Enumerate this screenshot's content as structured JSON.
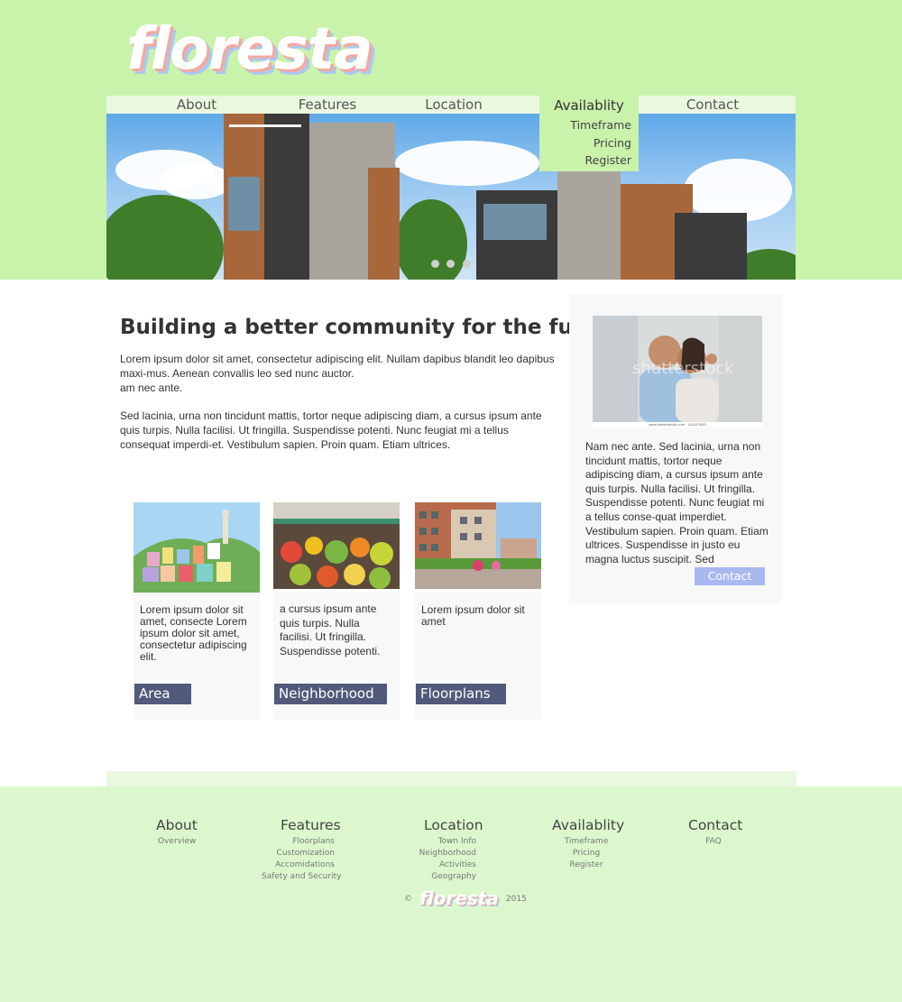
{
  "brand": {
    "logo_text": "floresta"
  },
  "nav": {
    "about": "About",
    "features": "Features",
    "location": "Location",
    "availability": "Availablity",
    "availability_sub": [
      "Timeframe",
      "Pricing",
      "Register"
    ],
    "contact": "Contact"
  },
  "hero": {
    "slide_count": 3
  },
  "main": {
    "headline": "Building a better community for the future™",
    "intro_p1": "Lorem ipsum dolor sit amet, consectetur adipiscing elit. Nullam dapibus blandit leo dapibus maxi-mus. Aenean convallis leo sed nunc auctor.",
    "intro_p1_tail": "am nec ante.",
    "intro_p2": "Sed lacinia, urna non tincidunt mattis, tortor neque adipiscing diam, a cursus ipsum ante quis turpis. Nulla facilisi. Ut fringilla. Suspendisse potenti. Nunc feugiat mi a tellus consequat imperdi-et. Vestibulum sapien. Proin quam. Etiam ultrices."
  },
  "cards": [
    {
      "text": "Lorem ipsum dolor sit amet, consecte  Lorem ipsum dolor sit amet, consectetur adipiscing elit.",
      "tag": "Area"
    },
    {
      "text": "a cursus ipsum ante quis turpis. Nulla facilisi. Ut fringilla. Suspendisse potenti.",
      "tag": "Neighborhood"
    },
    {
      "text": "Lorem ipsum dolor sit amet",
      "tag": "Floorplans"
    }
  ],
  "sidebar": {
    "photo_watermark": "shutterstock",
    "photo_caption": "www.shutterstock.com · 151413953",
    "text": "Nam nec ante. Sed lacinia, urna non tincidunt mattis, tortor neque adipiscing diam, a cursus ipsum ante quis turpis. Nulla facilisi. Ut fringilla. Suspendisse potenti. Nunc feugiat mi a tellus conse-quat imperdiet. Vestibulum sapien. Proin quam. Etiam ultrices. Suspendisse in justo eu magna luctus suscipit. Sed",
    "contact_button": "Contact"
  },
  "footer": {
    "columns": [
      {
        "heading": "About",
        "links": [
          "Overview"
        ]
      },
      {
        "heading": "Features",
        "links": [
          "Floorplans",
          "Customization",
          "Accomidations",
          "Safety and Security"
        ]
      },
      {
        "heading": "Location",
        "links": [
          "Town Info",
          "Neighborhood",
          "Activities",
          "Geography"
        ]
      },
      {
        "heading": "Availablity",
        "links": [
          "Timeframe",
          "Pricing",
          "Register"
        ]
      },
      {
        "heading": "Contact",
        "links": [
          "FAQ"
        ]
      }
    ],
    "copyright_symbol": "©",
    "copyright_logo": "floresta",
    "year": "2015"
  },
  "colors": {
    "header_bg": "#c9f2ab",
    "nav_bg": "#eaf8e0",
    "footer_bg": "#dcf7cd",
    "tag_bg": "#515a7a",
    "contact_button_bg": "#a9b8f0"
  }
}
